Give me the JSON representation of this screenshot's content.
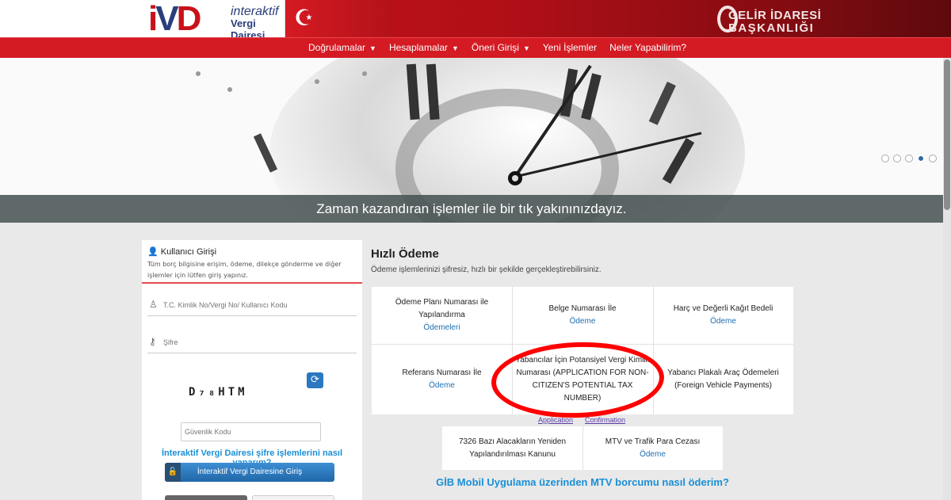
{
  "header": {
    "logo_mark_i": "i",
    "logo_mark_v": "V",
    "logo_mark_d": "D",
    "logo_line1": "interaktif",
    "logo_line2": "Vergi Dairesi",
    "gib_line1": "GELİR İDARESİ",
    "gib_line2": "BAŞKANLIĞI"
  },
  "nav": {
    "items": [
      {
        "label": "Doğrulamalar",
        "caret": "▼"
      },
      {
        "label": "Hesaplamalar",
        "caret": "▼"
      },
      {
        "label": "Öneri Girişi",
        "caret": "▼"
      },
      {
        "label": "Yeni İşlemler",
        "caret": ""
      },
      {
        "label": "Neler Yapabilirim?",
        "caret": ""
      }
    ]
  },
  "hero": {
    "caption": "Zaman kazandıran işlemler ile bir tık yakınınızdayız.",
    "slide_count": 5,
    "active_slide": 4
  },
  "login": {
    "title": "Kullanıcı Girişi",
    "subtitle": "Tüm borç bilgisine erişim, ödeme, dilekçe gönderme ve diğer işlemler için lütfen giriş yapınız.",
    "user_placeholder": "T.C. Kimlik No/Vergi No/ Kullanıcı Kodu",
    "password_placeholder": "Şifre",
    "captcha": "D₇₈HTM",
    "security_placeholder": "Güvenlik Kodu",
    "help_link": "İnteraktif Vergi Dairesi şifre işlemlerini nasıl yaparım?",
    "login_button": "İnteraktif Vergi Dairesine Giriş"
  },
  "quick_payment": {
    "title": "Hızlı Ödeme",
    "subtitle": "Ödeme işlemlerinizi şifresiz, hızlı bir şekilde gerçekleştirebilirsiniz.",
    "cells": [
      {
        "text": "Ödeme Planı Numarası ile Yapılandırma",
        "link": "Ödemeleri"
      },
      {
        "text": "Belge Numarası İle",
        "link": "Ödeme"
      },
      {
        "text": "Harç ve Değerli Kağıt Bedeli",
        "link": "Ödeme"
      },
      {
        "text": "Referans Numarası İle",
        "link": "Ödeme"
      },
      {
        "text": "Yabancılar İçin Potansiyel Vergi Kimlik Numarası (APPLICATION FOR NON-CITIZEN'S POTENTIAL TAX NUMBER)",
        "link": ""
      },
      {
        "text": "Yabancı Plakalı Araç Ödemeleri (Foreign Vehicle Payments)",
        "link": ""
      }
    ],
    "peek_left": "Application",
    "peek_right": "Confirmation",
    "cells2": [
      {
        "text": "7326 Bazı Alacakların Yeniden Yapılandırılması Kanunu",
        "link": ""
      },
      {
        "text": "MTV ve Trafik Para Cezası",
        "link": "Ödeme"
      }
    ],
    "mobile_link": "GİB Mobil Uygulama üzerinden MTV borcumu nasıl öderim?"
  },
  "colors": {
    "brand_red": "#d41a23",
    "link_blue": "#1a8fd6",
    "annotation_red": "#ff0000"
  }
}
